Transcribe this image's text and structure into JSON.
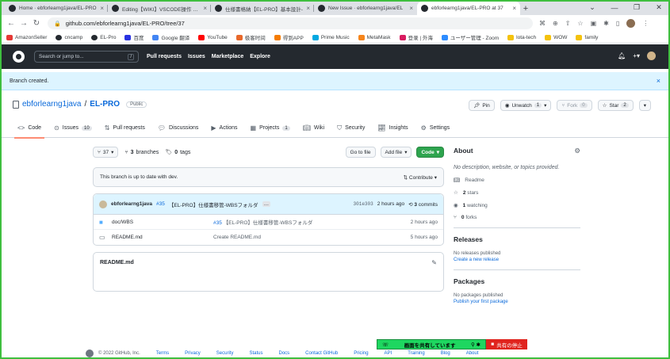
{
  "browser": {
    "tabs": [
      {
        "title": "Home · ebforlearng1java/EL-PRO"
      },
      {
        "title": "Editing【WIKI】VSCODE操作 Pull"
      },
      {
        "title": "仕様書格納【EL-PRO】基本設計-"
      },
      {
        "title": "New Issue · ebforlearng1java/EL"
      },
      {
        "title": "ebforlearng1java/EL-PRO at 37"
      }
    ],
    "url": "github.com/ebforlearng1java/EL-PRO/tree/37",
    "bookmarks": [
      "AmazonSeller",
      "cncamp",
      "EL-Pro",
      "百度",
      "Google 翻译",
      "YouTube",
      "极客时间",
      "得到APP",
      "Prime Music",
      "MetaMask",
      "登录 | 外海",
      "ユーザー管理 - Zoom",
      "lota-tech",
      "WOW",
      "family"
    ]
  },
  "header": {
    "search_placeholder": "Search or jump to...",
    "search_key": "/",
    "nav": [
      "Pull requests",
      "Issues",
      "Marketplace",
      "Explore"
    ]
  },
  "flash": {
    "message": "Branch created.",
    "close": "×"
  },
  "repo": {
    "owner": "ebforlearng1java",
    "sep": "/",
    "name": "EL-PRO",
    "visibility": "Public",
    "pin": "Pin",
    "unwatch": "Unwatch",
    "unwatch_count": "1",
    "fork": "Fork",
    "fork_count": "0",
    "star": "Star",
    "star_count": "2"
  },
  "tabs": [
    {
      "label": "Code",
      "count": ""
    },
    {
      "label": "Issues",
      "count": "10"
    },
    {
      "label": "Pull requests",
      "count": ""
    },
    {
      "label": "Discussions",
      "count": ""
    },
    {
      "label": "Actions",
      "count": ""
    },
    {
      "label": "Projects",
      "count": "1"
    },
    {
      "label": "Wiki",
      "count": ""
    },
    {
      "label": "Security",
      "count": ""
    },
    {
      "label": "Insights",
      "count": ""
    },
    {
      "label": "Settings",
      "count": ""
    }
  ],
  "toolbar": {
    "branch": "37",
    "branches_count": "3",
    "branches_label": "branches",
    "tags_count": "0",
    "tags_label": "tags",
    "go_to_file": "Go to file",
    "add_file": "Add file",
    "code": "Code"
  },
  "up_to_date": {
    "message": "This branch is up to date with dev.",
    "contribute": "Contribute"
  },
  "commit": {
    "author": "ebforlearng1java",
    "pr": "#35",
    "message": "【EL-PRO】仕様書移管-WBSフォルダ",
    "ellipsis": "…",
    "sha": "301e303",
    "age": "2 hours ago",
    "count": "3",
    "count_label": "commits"
  },
  "files": [
    {
      "name": "doc/WBS",
      "msg_link": "#35",
      "msg": "【EL-PRO】仕様書移管-WBSフォルダ",
      "age": "2 hours ago"
    },
    {
      "name": "README.md",
      "msg_link": "",
      "msg": "Create README.md",
      "age": "5 hours ago"
    }
  ],
  "readme": {
    "title": "README.md"
  },
  "about": {
    "title": "About",
    "description": "No description, website, or topics provided.",
    "readme": "Readme",
    "stars": "2",
    "stars_label": "stars",
    "watching": "1",
    "watching_label": "watching",
    "forks": "0",
    "forks_label": "forks"
  },
  "releases": {
    "title": "Releases",
    "none": "No releases published",
    "link": "Create a new release"
  },
  "packages": {
    "title": "Packages",
    "none": "No packages published",
    "link": "Publish your first package"
  },
  "footer": {
    "copyright": "© 2022 GitHub, Inc.",
    "links": [
      "Terms",
      "Privacy",
      "Security",
      "Status",
      "Docs",
      "Contact GitHub",
      "Pricing",
      "API",
      "Training",
      "Blog",
      "About"
    ]
  },
  "share_bar": {
    "sharing": "画面を共有しています",
    "stop": "共有の停止"
  },
  "colors": {
    "accent": "#0969da",
    "green": "#2da44e",
    "header": "#24292f",
    "flash": "#ddf4ff",
    "share_green": "#1ed760",
    "share_red": "#e0241e"
  }
}
